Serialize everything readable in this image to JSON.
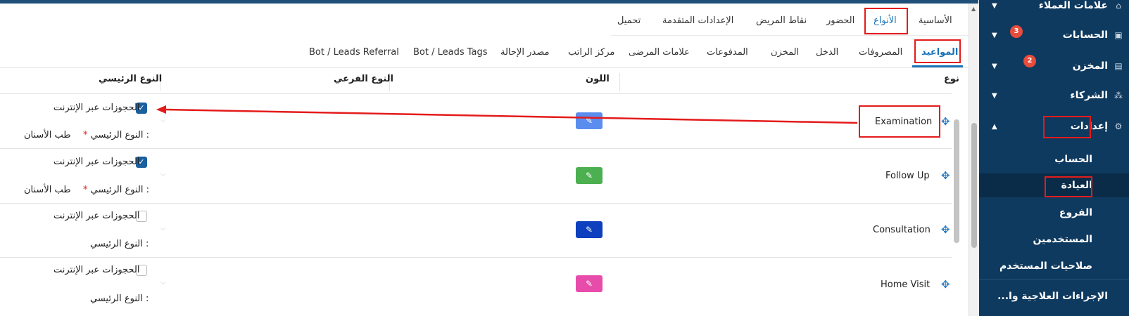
{
  "tabs_main": [
    {
      "label": "الأساسية",
      "active": false
    },
    {
      "label": "الأنواع",
      "active": true
    },
    {
      "label": "الحضور",
      "active": false
    },
    {
      "label": "نقاط المريض",
      "active": false
    },
    {
      "label": "الإعدادات المتقدمة",
      "active": false
    },
    {
      "label": "تحميل",
      "active": false
    }
  ],
  "tabs_sub": [
    {
      "label": "المواعيد",
      "active": true
    },
    {
      "label": "المصروفات"
    },
    {
      "label": "الدخل"
    },
    {
      "label": "المخزن"
    },
    {
      "label": "المدفوعات"
    },
    {
      "label": "علامات المرضى"
    },
    {
      "label": "مركز الراتب"
    },
    {
      "label": "مصدر الإحالة"
    },
    {
      "label": "Bot / Leads Tags"
    },
    {
      "label": "Bot / Leads Referral"
    }
  ],
  "table": {
    "headers": {
      "type": "نوع",
      "color": "اللون",
      "sub_type": "النوع الفرعي",
      "main_type": "النوع الرئيسي"
    },
    "online_booking_label": "الحجوزات عبر الإنترنت",
    "main_type_label": "النوع الرئيسي :",
    "rows": [
      {
        "name": "Examination",
        "color": "#5b8def",
        "online": true,
        "main_type_value": "طب الأسنان",
        "required": true
      },
      {
        "name": "Follow Up",
        "color": "#4caf50",
        "online": true,
        "main_type_value": "طب الأسنان",
        "required": true
      },
      {
        "name": "Consultation",
        "color": "#0d3fbf",
        "online": false,
        "main_type_value": "",
        "required": false
      },
      {
        "name": "Home Visit",
        "color": "#e84caa",
        "online": false,
        "main_type_value": "",
        "required": false
      }
    ]
  },
  "sidebar": {
    "items": [
      {
        "label": "علامات العملاء",
        "icon": "tag-icon"
      },
      {
        "label": "الحسابات",
        "icon": "accounts-icon",
        "badge": "3"
      },
      {
        "label": "المخزن",
        "icon": "inventory-icon",
        "badge": "2"
      },
      {
        "label": "الشركاء",
        "icon": "partners-icon"
      },
      {
        "label": "إعدادات",
        "icon": "gear-icon"
      }
    ],
    "sub_items": [
      "الحساب",
      "العيادة",
      "الفروع",
      "المستخدمين",
      "صلاحيات المستخدم"
    ],
    "bottom_item": "الإجراءات العلاجية وا..."
  },
  "colors": {
    "accent": "#1a73b8",
    "sidebar_bg": "#0f3a5f",
    "highlight": "#e41b1b"
  }
}
